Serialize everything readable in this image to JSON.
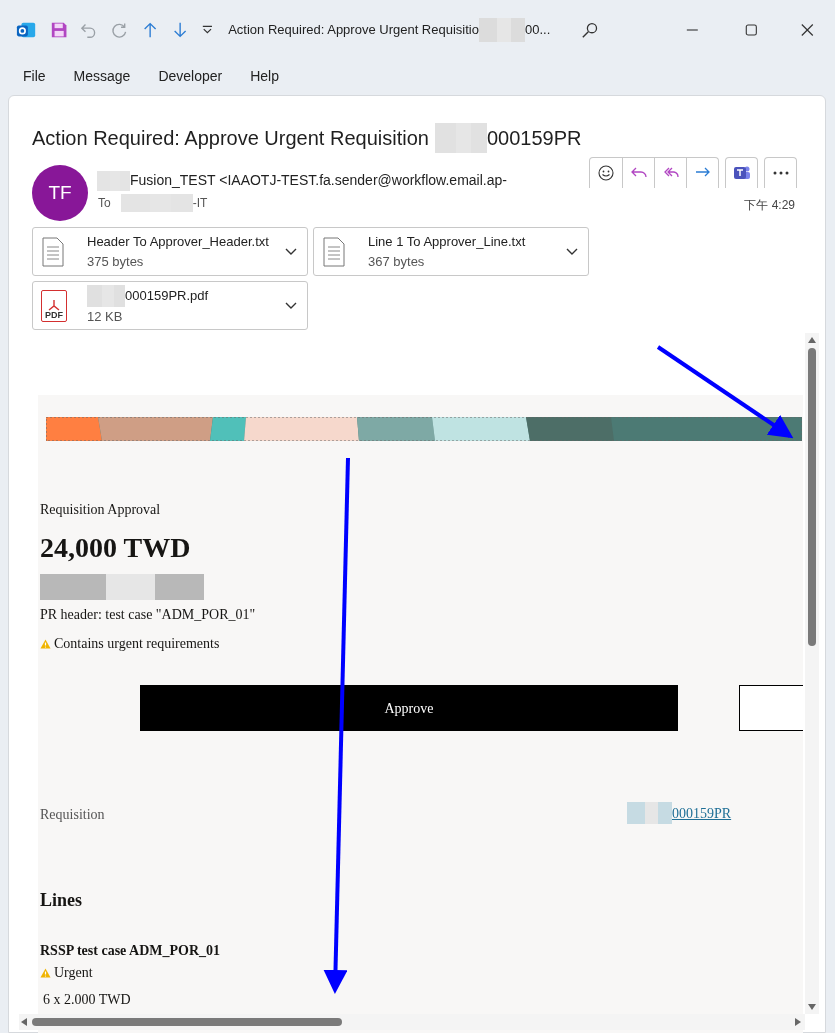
{
  "window": {
    "title_prefix": "Action Required: Approve Urgent Requisitio",
    "title_suffix": "00..."
  },
  "menu": [
    {
      "label": "File"
    },
    {
      "label": "Message"
    },
    {
      "label": "Developer"
    },
    {
      "label": "Help"
    }
  ],
  "message": {
    "subject_prefix": "Action Required: Approve Urgent Requisition",
    "subject_suffix": "000159PR",
    "avatar": "TF",
    "sender": "Fusion_TEST <IAAOTJ-TEST.fa.sender@workflow.email.ap-",
    "to_label": "To",
    "to_suffix": "-IT",
    "time": "下午 4:29"
  },
  "attachments": [
    {
      "kind": "text",
      "name": "Header To Approver_Header.txt",
      "size": "375 bytes"
    },
    {
      "kind": "text",
      "name": "Line 1 To Approver_Line.txt",
      "size": "367 bytes"
    },
    {
      "kind": "pdf",
      "name": "000159PR.pdf",
      "size": "12 KB",
      "pdf_label": "PDF"
    }
  ],
  "body": {
    "heading": "Requisition Approval",
    "amount": "24,000 TWD",
    "description": "PR header: test case \"ADM_POR_01\"",
    "warning": "Contains urgent requirements",
    "approve_button": "Approve",
    "requisition_label": "Requisition",
    "requisition_link": "000159PR",
    "lines_heading": "Lines",
    "lines": [
      {
        "title": "RSSP test case ADM_POR_01",
        "warning": "Urgent",
        "quantity": "6 x 2.000 TWD"
      }
    ]
  }
}
